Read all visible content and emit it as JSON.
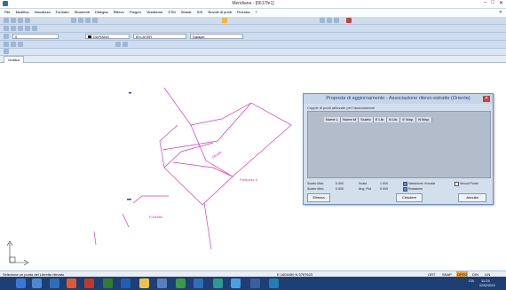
{
  "window": {
    "title": "Meridiana - [0617fe1]"
  },
  "menu": [
    "File",
    "Modifica",
    "Visualizza",
    "Formato",
    "Strumenti",
    "Disegna",
    "Rilievo",
    "Pregeo",
    "Vestizione",
    "STM",
    "Strade",
    "SIS",
    "Nuvole di punti",
    "Finestra",
    "?"
  ],
  "properties": {
    "layer": "0",
    "color": "DAPIANO",
    "linetype": "BYLAYER",
    "lineweight": "Dalayer"
  },
  "tabs": [
    "Grafica"
  ],
  "dialog": {
    "title": "Proposta di aggiornamento - Associazione rilievo-estratto (Orienta)",
    "group_label": "Coppie di punti utilizzate per l'associazione",
    "columns": [
      "Nome L",
      "Nome M",
      "Scarto",
      "E Lib.",
      "N Lib.",
      "E Map.",
      "N Map."
    ],
    "fields": [
      {
        "label": "Scarto Max.",
        "value": "0.000"
      },
      {
        "label": "Scarto Med.",
        "value": "0.000"
      },
      {
        "label": "Scala",
        "value": "1.000"
      },
      {
        "label": "Ang. Rot.",
        "value": "0.000"
      }
    ],
    "checks": [
      {
        "label": "Variazione di scala",
        "checked": true
      },
      {
        "label": "Rotazione",
        "checked": true
      },
      {
        "label": "Vincoli Punto",
        "checked": false
      }
    ],
    "buttons": {
      "delete": "Elimina",
      "close": "Chiudere",
      "apply": "Annulla"
    }
  },
  "drawing_labels": [
    "Particella 5",
    "Strada",
    "Fossetto"
  ],
  "status": {
    "hint": "Selezione un punto del Libretto rilevato",
    "coords": "E 1604450 N 5787623",
    "modes": [
      "ORT",
      "SNAP",
      "ORTO",
      "DIN",
      "LIN"
    ],
    "time": "11:24",
    "date": "02/02/2015",
    "lang": "ITA"
  }
}
